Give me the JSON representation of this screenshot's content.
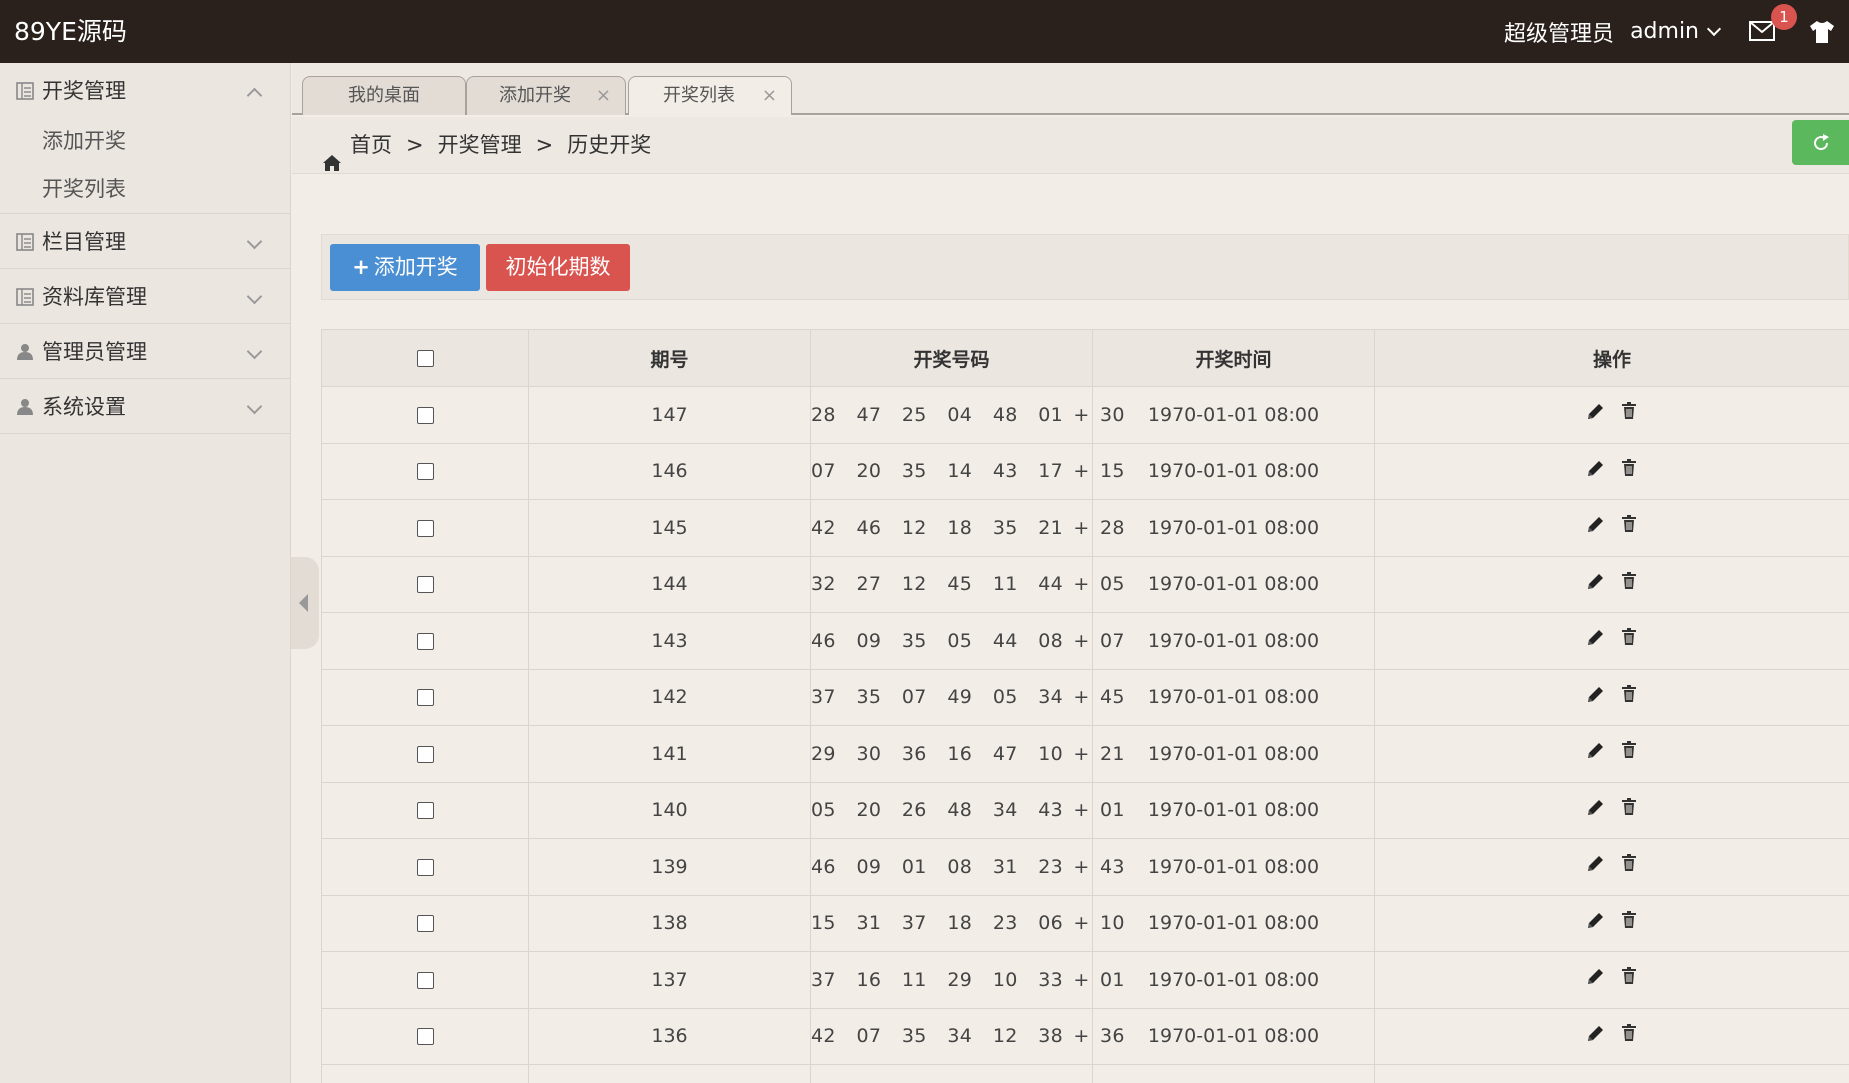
{
  "brand": "89YE源码",
  "user": {
    "role": "超级管理员",
    "name": "admin",
    "notifications": "1"
  },
  "sidebar": {
    "groups": [
      {
        "label": "开奖管理",
        "icon": "list-icon",
        "expanded": true,
        "items": [
          "添加开奖",
          "开奖列表"
        ]
      },
      {
        "label": "栏目管理",
        "icon": "list-icon",
        "expanded": false,
        "items": []
      },
      {
        "label": "资料库管理",
        "icon": "list-icon",
        "expanded": false,
        "items": []
      },
      {
        "label": "管理员管理",
        "icon": "user-icon",
        "expanded": false,
        "items": []
      },
      {
        "label": "系统设置",
        "icon": "user-icon",
        "expanded": false,
        "items": []
      }
    ]
  },
  "tabs": [
    {
      "label": "我的桌面",
      "closable": false
    },
    {
      "label": "添加开奖",
      "closable": true,
      "close": "×"
    },
    {
      "label": "开奖列表",
      "closable": true,
      "close": "×",
      "active": true
    }
  ],
  "breadcrumb": {
    "home": "首页",
    "sep": ">",
    "level1": "开奖管理",
    "level2": "历史开奖"
  },
  "toolbar": {
    "add_label": "添加开奖",
    "init_label": "初始化期数"
  },
  "table": {
    "headers": [
      "期号",
      "开奖号码",
      "开奖时间",
      "操作"
    ],
    "rows": [
      {
        "issue": "147",
        "numbers": "28  47  25  04  48  01 + 30",
        "time": "1970-01-01 08:00"
      },
      {
        "issue": "146",
        "numbers": "07  20  35  14  43  17 + 15",
        "time": "1970-01-01 08:00"
      },
      {
        "issue": "145",
        "numbers": "42  46  12  18  35  21 + 28",
        "time": "1970-01-01 08:00"
      },
      {
        "issue": "144",
        "numbers": "32  27  12  45  11  44 + 05",
        "time": "1970-01-01 08:00"
      },
      {
        "issue": "143",
        "numbers": "46  09  35  05  44  08 + 07",
        "time": "1970-01-01 08:00"
      },
      {
        "issue": "142",
        "numbers": "37  35  07  49  05  34 + 45",
        "time": "1970-01-01 08:00"
      },
      {
        "issue": "141",
        "numbers": "29  30  36  16  47  10 + 21",
        "time": "1970-01-01 08:00"
      },
      {
        "issue": "140",
        "numbers": "05  20  26  48  34  43 + 01",
        "time": "1970-01-01 08:00"
      },
      {
        "issue": "139",
        "numbers": "46  09  01  08  31  23 + 43",
        "time": "1970-01-01 08:00"
      },
      {
        "issue": "138",
        "numbers": "15  31  37  18  23  06 + 10",
        "time": "1970-01-01 08:00"
      },
      {
        "issue": "137",
        "numbers": "37  16  11  29  10  33 + 01",
        "time": "1970-01-01 08:00"
      },
      {
        "issue": "136",
        "numbers": "42  07  35  34  12  38 + 36",
        "time": "1970-01-01 08:00"
      },
      {
        "issue": "",
        "numbers": "",
        "time": ""
      }
    ]
  },
  "colors": {
    "topbar": "#2a201c",
    "primary": "#4a8fd3",
    "danger": "#d9534f",
    "success": "#5cb85c"
  }
}
